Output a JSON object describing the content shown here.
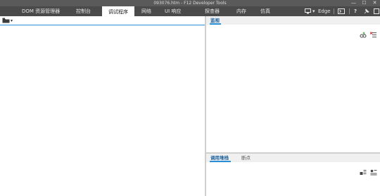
{
  "window": {
    "title": "093076.htm - F12 Developer Tools",
    "controls": [
      "—",
      "☐",
      "✕"
    ]
  },
  "tabs": [
    {
      "label": "DOM 资源管理器",
      "active": false
    },
    {
      "label": "控制台",
      "active": false
    },
    {
      "label": "调试程序",
      "active": true
    },
    {
      "label": "网络",
      "active": false
    },
    {
      "label": "UI 响应",
      "active": false
    },
    {
      "label": "探查器",
      "active": false
    },
    {
      "label": "内存",
      "active": false
    },
    {
      "label": "仿真",
      "active": false
    }
  ],
  "toolbar_right": {
    "emulation_label": "Edge",
    "help_label": "?"
  },
  "watch_panel": {
    "title": "监视"
  },
  "bottom_panel": {
    "tabs": [
      {
        "label": "调用堆栈",
        "active": true
      },
      {
        "label": "断点",
        "active": false
      }
    ]
  },
  "colors": {
    "accent": "#2b8fd6",
    "tabbar_bg": "#4a4a4a",
    "titlebar_bg": "#5a5a5a"
  }
}
